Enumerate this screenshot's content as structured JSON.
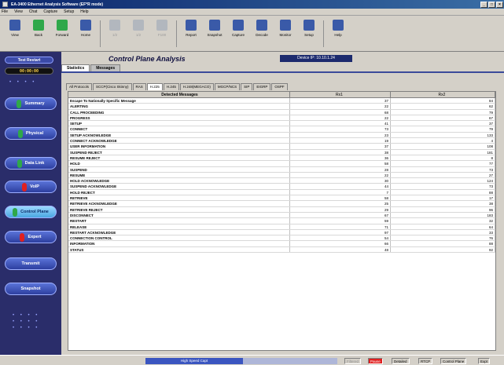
{
  "window": {
    "title": "EA-3400 Ethernet Analysis Software (EF*R mode)"
  },
  "menu": [
    "File",
    "View",
    "Chat",
    "Capture",
    "Setup",
    "Help"
  ],
  "toolbar": [
    {
      "label": "View",
      "icon": "monitor-icon",
      "color": "#3a5aa8",
      "disabled": false
    },
    {
      "label": "Back",
      "icon": "back-arrow-icon",
      "color": "#2fa84a",
      "disabled": false
    },
    {
      "label": "Forward",
      "icon": "forward-arrow-icon",
      "color": "#2fa84a",
      "disabled": false
    },
    {
      "label": "Home",
      "icon": "home-icon",
      "color": "#3a5aa8",
      "disabled": false
    },
    {
      "sep": true
    },
    {
      "label": "1/2",
      "icon": "window-icon",
      "color": "#8090b0",
      "disabled": true
    },
    {
      "label": "1/2",
      "icon": "gauge-icon",
      "color": "#8090b0",
      "disabled": true
    },
    {
      "label": "F100",
      "icon": "page-icon",
      "color": "#8090b0",
      "disabled": true
    },
    {
      "sep": true
    },
    {
      "label": "Report",
      "icon": "report-icon",
      "color": "#3a5aa8",
      "disabled": false
    },
    {
      "label": "Snapshot",
      "icon": "camera-icon",
      "color": "#3a5aa8",
      "disabled": false
    },
    {
      "label": "Capture",
      "icon": "capture-icon",
      "color": "#3a5aa8",
      "disabled": false
    },
    {
      "label": "Decode",
      "icon": "decode-icon",
      "color": "#3a5aa8",
      "disabled": false
    },
    {
      "label": "Monitor",
      "icon": "monitor-screen-icon",
      "color": "#3a5aa8",
      "disabled": false
    },
    {
      "label": "Setup",
      "icon": "setup-icon",
      "color": "#3a5aa8",
      "disabled": false
    },
    {
      "sep": true
    },
    {
      "label": "Help",
      "icon": "help-book-icon",
      "color": "#3a5aa8",
      "disabled": false
    }
  ],
  "sidebar": {
    "test_label": "Test Restart",
    "clock": "00:00:00",
    "nav": [
      {
        "label": "Summary",
        "led": "#2fa84a",
        "active": false
      },
      {
        "label": "Physical",
        "led": "#2fa84a",
        "active": false
      },
      {
        "label": "Data Link",
        "led": "#2fa84a",
        "active": false
      },
      {
        "label": "VoIP",
        "led": "#e02020",
        "active": false
      },
      {
        "label": "Control Plane",
        "led": "#2fa84a",
        "active": true
      },
      {
        "label": "Expert",
        "led": "#e02020",
        "active": false
      },
      {
        "label": "Transmit",
        "led": "",
        "active": false
      },
      {
        "label": "Snapshot",
        "led": "",
        "active": false
      }
    ]
  },
  "main": {
    "title": "Control Plane Analysis",
    "device_ip": "Device IP: 10.10.1.24",
    "view_tabs": [
      {
        "label": "Statistics",
        "active": true
      },
      {
        "label": "Messages",
        "active": false
      }
    ],
    "proto_tabs": [
      {
        "label": "All Protocols",
        "active": false
      },
      {
        "label": "SCCP(Cisco Skinny)",
        "active": false
      },
      {
        "label": "RAS",
        "active": false
      },
      {
        "label": "H.225",
        "active": true
      },
      {
        "label": "H.245",
        "active": false
      },
      {
        "label": "H.248(MEGACO)",
        "active": false
      },
      {
        "label": "MGCP/NCS",
        "active": false
      },
      {
        "label": "SIP",
        "active": false
      },
      {
        "label": "EIGRP",
        "active": false
      },
      {
        "label": "OSPF",
        "active": false
      }
    ],
    "grid": {
      "columns": [
        "Detected Messages",
        "Rx1",
        "Rx2"
      ],
      "rows": [
        [
          "Escape To Nationally Specific Message",
          "37",
          "84"
        ],
        [
          "ALERTING",
          "22",
          "62"
        ],
        [
          "CALL PROCEEDING",
          "68",
          "79"
        ],
        [
          "PROGRESS",
          "22",
          "67"
        ],
        [
          "SETUP",
          "41",
          "37"
        ],
        [
          "CONNECT",
          "73",
          "79"
        ],
        [
          "SETUP ACKNOWLEDGE",
          "23",
          "133"
        ],
        [
          "CONNECT ACKNOWLEDGE",
          "19",
          "4"
        ],
        [
          "USER INFORMATION",
          "37",
          "108"
        ],
        [
          "SUSPEND REJECT",
          "38",
          "181"
        ],
        [
          "RESUME REJECT",
          "36",
          "8"
        ],
        [
          "HOLD",
          "58",
          "77"
        ],
        [
          "SUSPEND",
          "28",
          "73"
        ],
        [
          "RESUME",
          "22",
          "27"
        ],
        [
          "HOLD ACKNOWLEDGE",
          "30",
          "124"
        ],
        [
          "SUSPEND ACKNOWLEDGE",
          "44",
          "73"
        ],
        [
          "HOLD REJECT",
          "7",
          "88"
        ],
        [
          "RETRIEVE",
          "58",
          "17"
        ],
        [
          "RETRIEVE ACKNOWLEDGE",
          "25",
          "38"
        ],
        [
          "RETRIEVE REJECT",
          "29",
          "96"
        ],
        [
          "DISCONNECT",
          "67",
          "183"
        ],
        [
          "RESTART",
          "59",
          "32"
        ],
        [
          "RELEASE",
          "71",
          "64"
        ],
        [
          "RESTART ACKNOWLEDGE",
          "97",
          "33"
        ],
        [
          "CONNECTION CONTROL",
          "54",
          "76"
        ],
        [
          "INFORMATION",
          "66",
          "88"
        ],
        [
          "STATUS",
          "48",
          "92"
        ]
      ]
    }
  },
  "statusbar": {
    "progress_label": "High Speed Capt",
    "items": [
      {
        "label": "Filtered",
        "left": 0,
        "style": "muted"
      },
      {
        "label": "Pause",
        "left": 0,
        "style": "alarm"
      },
      {
        "label": "Detailed",
        "left": 0,
        "style": ""
      },
      {
        "label": "RTCP",
        "left": 0,
        "style": ""
      },
      {
        "label": "Control Plane",
        "left": 0,
        "style": ""
      },
      {
        "label": "Expt",
        "left": 0,
        "style": ""
      }
    ]
  }
}
